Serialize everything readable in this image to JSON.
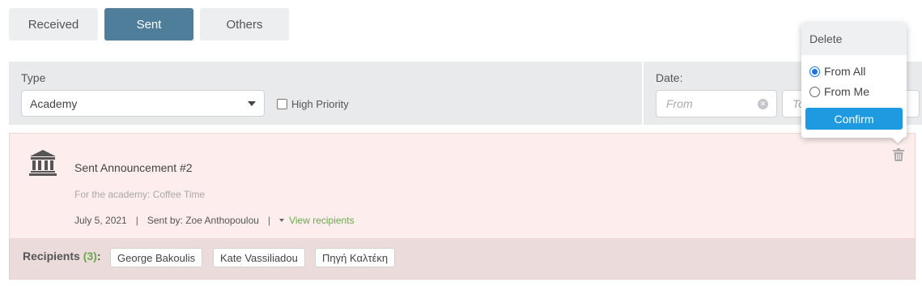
{
  "tabs": [
    {
      "label": "Received",
      "active": false
    },
    {
      "label": "Sent",
      "active": true
    },
    {
      "label": "Others",
      "active": false
    }
  ],
  "filters": {
    "type_label": "Type",
    "type_value": "Academy",
    "high_priority_label": "High Priority",
    "high_priority_checked": false,
    "date_label": "Date:",
    "date_from_placeholder": "From",
    "date_to_placeholder": "To"
  },
  "announcement": {
    "icon": "academy-building-icon",
    "title": "Sent Announcement #2",
    "subtitle": "For the academy: Coffee Time",
    "date": "July 5, 2021",
    "sent_by": "Sent by: Zoe Anthopoulou",
    "view_recipients": "View recipients"
  },
  "recipients": {
    "label": "Recipients",
    "count": "(3)",
    "items": [
      "George Bakoulis",
      "Kate Vassiliadou",
      "Πηγή Καλτέκη"
    ]
  },
  "delete_popover": {
    "title": "Delete",
    "options": [
      {
        "label": "From All",
        "selected": true
      },
      {
        "label": "From Me",
        "selected": false
      }
    ],
    "confirm_label": "Confirm"
  },
  "colors": {
    "active_tab": "#4e7e99",
    "confirm_button": "#1e9be0",
    "link_green": "#6aa84f",
    "card_bg": "#fdeeed"
  }
}
